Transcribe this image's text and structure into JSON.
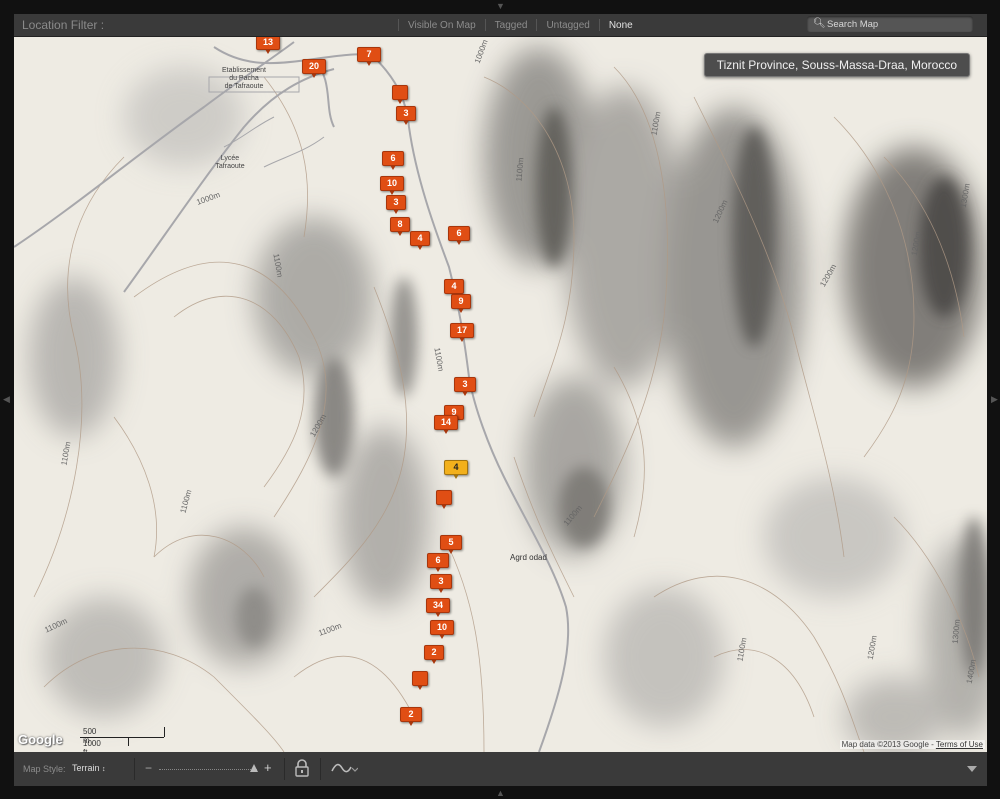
{
  "toolbar": {
    "title": "Location Filter :",
    "filters": [
      "Visible On Map",
      "Tagged",
      "Untagged",
      "None"
    ],
    "active_filter": "None",
    "search_placeholder": "Search Map"
  },
  "map": {
    "location_label": "Tiznit Province, Souss-Massa-Draa, Morocco",
    "places": {
      "establishment": "Etablissement\ndu Pacha\nde Tafraoute",
      "lycee": "Lycée\nTafraoute",
      "village": "Agrd odad"
    },
    "contour_labels": [
      "1000m",
      "1000m",
      "1100m",
      "1100m",
      "1100m",
      "1100m",
      "1200m",
      "1200m",
      "1100m",
      "1100m",
      "1200m",
      "1100m",
      "1100m",
      "1200m",
      "1300m",
      "1200m",
      "1100m",
      "1100m",
      "1300m",
      "1400m"
    ],
    "pins": [
      "13",
      "7",
      "20",
      "",
      "3",
      "6",
      "10",
      "3",
      "8",
      "4",
      "6",
      "4",
      "9",
      "17",
      "3",
      "9",
      "14",
      "4",
      "",
      "5",
      "6",
      "3",
      "34",
      "10",
      "2",
      "",
      "2"
    ],
    "selected_pin_index": 17,
    "scale": {
      "metric": "500 m",
      "imperial": "1000 ft"
    },
    "logo": "Google",
    "attribution": {
      "text": "Map data ©2013 Google - ",
      "link": "Terms of Use"
    }
  },
  "bottom_bar": {
    "map_style_label": "Map Style:",
    "map_style_value": "Terrain",
    "zoom_level": 0.9,
    "icons": [
      "zoom-out-icon",
      "zoom-in-icon",
      "lock-icon",
      "tracklog-icon",
      "collapse-icon"
    ]
  }
}
